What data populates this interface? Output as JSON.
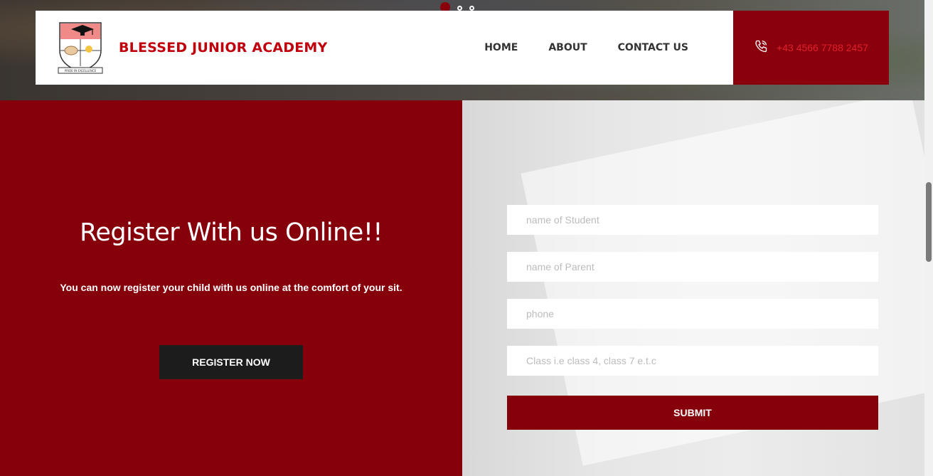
{
  "brand": {
    "name": "BLESSED JUNIOR ACADEMY",
    "motto": "PRIDE IN EXCELLENCE"
  },
  "nav": {
    "items": [
      {
        "label": "HOME"
      },
      {
        "label": "ABOUT"
      },
      {
        "label": "CONTACT US"
      }
    ]
  },
  "contact": {
    "phone": "+43 4566 7788 2457"
  },
  "register": {
    "heading": "Register With us Online!!",
    "text": "You can now register your child with us online at the comfort of your sit.",
    "button": "REGISTER NOW"
  },
  "form": {
    "student_placeholder": "name of Student",
    "parent_placeholder": "name of Parent",
    "phone_placeholder": "phone",
    "class_placeholder": "Class i.e class 4, class 7 e.t.c",
    "submit": "SUBMIT"
  },
  "colors": {
    "accent": "#86000b",
    "brand_text": "#c0000c",
    "dark_button": "#1c1c1c"
  },
  "slider": {
    "dot_count": 3,
    "active_index": 0
  }
}
